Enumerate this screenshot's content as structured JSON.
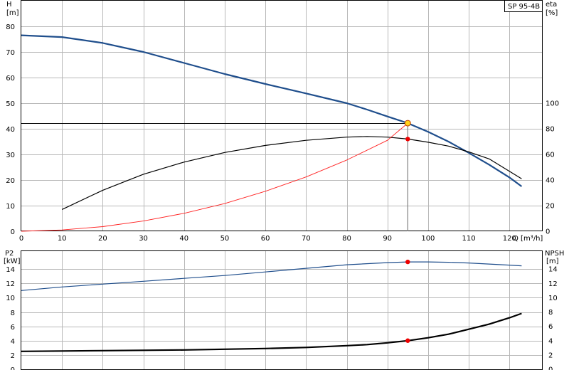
{
  "chart_data": [
    {
      "type": "line",
      "panel": "top",
      "label_box": "SP 95-4B",
      "xlabel": "Q [m³/h]",
      "ylabel_left": "H",
      "ylabel_left_unit": "[m]",
      "ylabel_right": "eta",
      "ylabel_right_unit": "[%]",
      "xlim": [
        0,
        128
      ],
      "ylim_left": [
        0,
        90
      ],
      "ylim_right": [
        0,
        180
      ],
      "x_ticks": [
        0,
        10,
        20,
        30,
        40,
        50,
        60,
        70,
        80,
        90,
        100,
        110,
        120
      ],
      "y_left_ticks": [
        0,
        10,
        20,
        30,
        40,
        50,
        60,
        70,
        80
      ],
      "y_right_ticks": [
        0,
        20,
        40,
        60,
        80,
        100
      ],
      "series": [
        {
          "color": "#1f4e8c",
          "axis": "left",
          "x": [
            0,
            10,
            20,
            30,
            40,
            50,
            60,
            70,
            80,
            85,
            90,
            95,
            100,
            105,
            110,
            115,
            120,
            123
          ],
          "y": [
            76.5,
            75.8,
            73.5,
            70,
            65.7,
            61.4,
            57.5,
            53.8,
            50,
            47.5,
            44.8,
            42.2,
            38.8,
            35,
            30.6,
            26,
            21,
            17.5
          ]
        },
        {
          "color": "#000000",
          "axis": "right",
          "x": [
            10,
            20,
            30,
            40,
            50,
            60,
            70,
            80,
            85,
            90,
            95,
            100,
            105,
            110,
            115,
            123
          ],
          "y": [
            17,
            32,
            44.5,
            54,
            61.5,
            67,
            71,
            73.5,
            74,
            73.5,
            72,
            69.5,
            66.5,
            62,
            56.5,
            41
          ]
        },
        {
          "color": "#ff2020",
          "axis": "left",
          "x": [
            0,
            10,
            20,
            30,
            40,
            50,
            60,
            70,
            80,
            90,
            95
          ],
          "y": [
            0,
            0.5,
            1.8,
            4,
            7,
            10.8,
            15.6,
            21.2,
            27.8,
            35.5,
            42.2
          ]
        }
      ],
      "operating_point": {
        "q": 95,
        "h": 42.2,
        "eta": 72
      }
    },
    {
      "type": "line",
      "panel": "bottom",
      "ylabel_left": "P2",
      "ylabel_left_unit": "[kW]",
      "ylabel_right": "NPSH",
      "ylabel_right_unit": "[m]",
      "xlim": [
        0,
        128
      ],
      "ylim_left": [
        0,
        16.5
      ],
      "ylim_right": [
        0,
        16.5
      ],
      "y_left_ticks": [
        0,
        2,
        4,
        6,
        8,
        10,
        12,
        14
      ],
      "y_right_ticks": [
        0,
        2,
        4,
        6,
        8,
        10,
        12,
        14
      ],
      "series": [
        {
          "color": "#1f4e8c",
          "axis": "left",
          "x": [
            0,
            10,
            20,
            30,
            40,
            50,
            60,
            70,
            80,
            90,
            95,
            100,
            105,
            110,
            115,
            120,
            123
          ],
          "y": [
            11,
            11.5,
            11.9,
            12.3,
            12.7,
            13.1,
            13.6,
            14.1,
            14.6,
            14.9,
            15,
            15,
            14.95,
            14.85,
            14.7,
            14.55,
            14.45
          ]
        },
        {
          "color": "#000000",
          "axis": "right",
          "x": [
            0,
            10,
            20,
            30,
            40,
            50,
            60,
            70,
            80,
            85,
            90,
            95,
            100,
            105,
            110,
            115,
            120,
            123
          ],
          "y": [
            2.5,
            2.55,
            2.6,
            2.65,
            2.7,
            2.8,
            2.9,
            3.05,
            3.3,
            3.45,
            3.7,
            4,
            4.4,
            4.9,
            5.6,
            6.3,
            7.2,
            7.8
          ]
        }
      ],
      "operating_point": {
        "q": 95,
        "p2": 15,
        "npsh": 4
      }
    }
  ]
}
